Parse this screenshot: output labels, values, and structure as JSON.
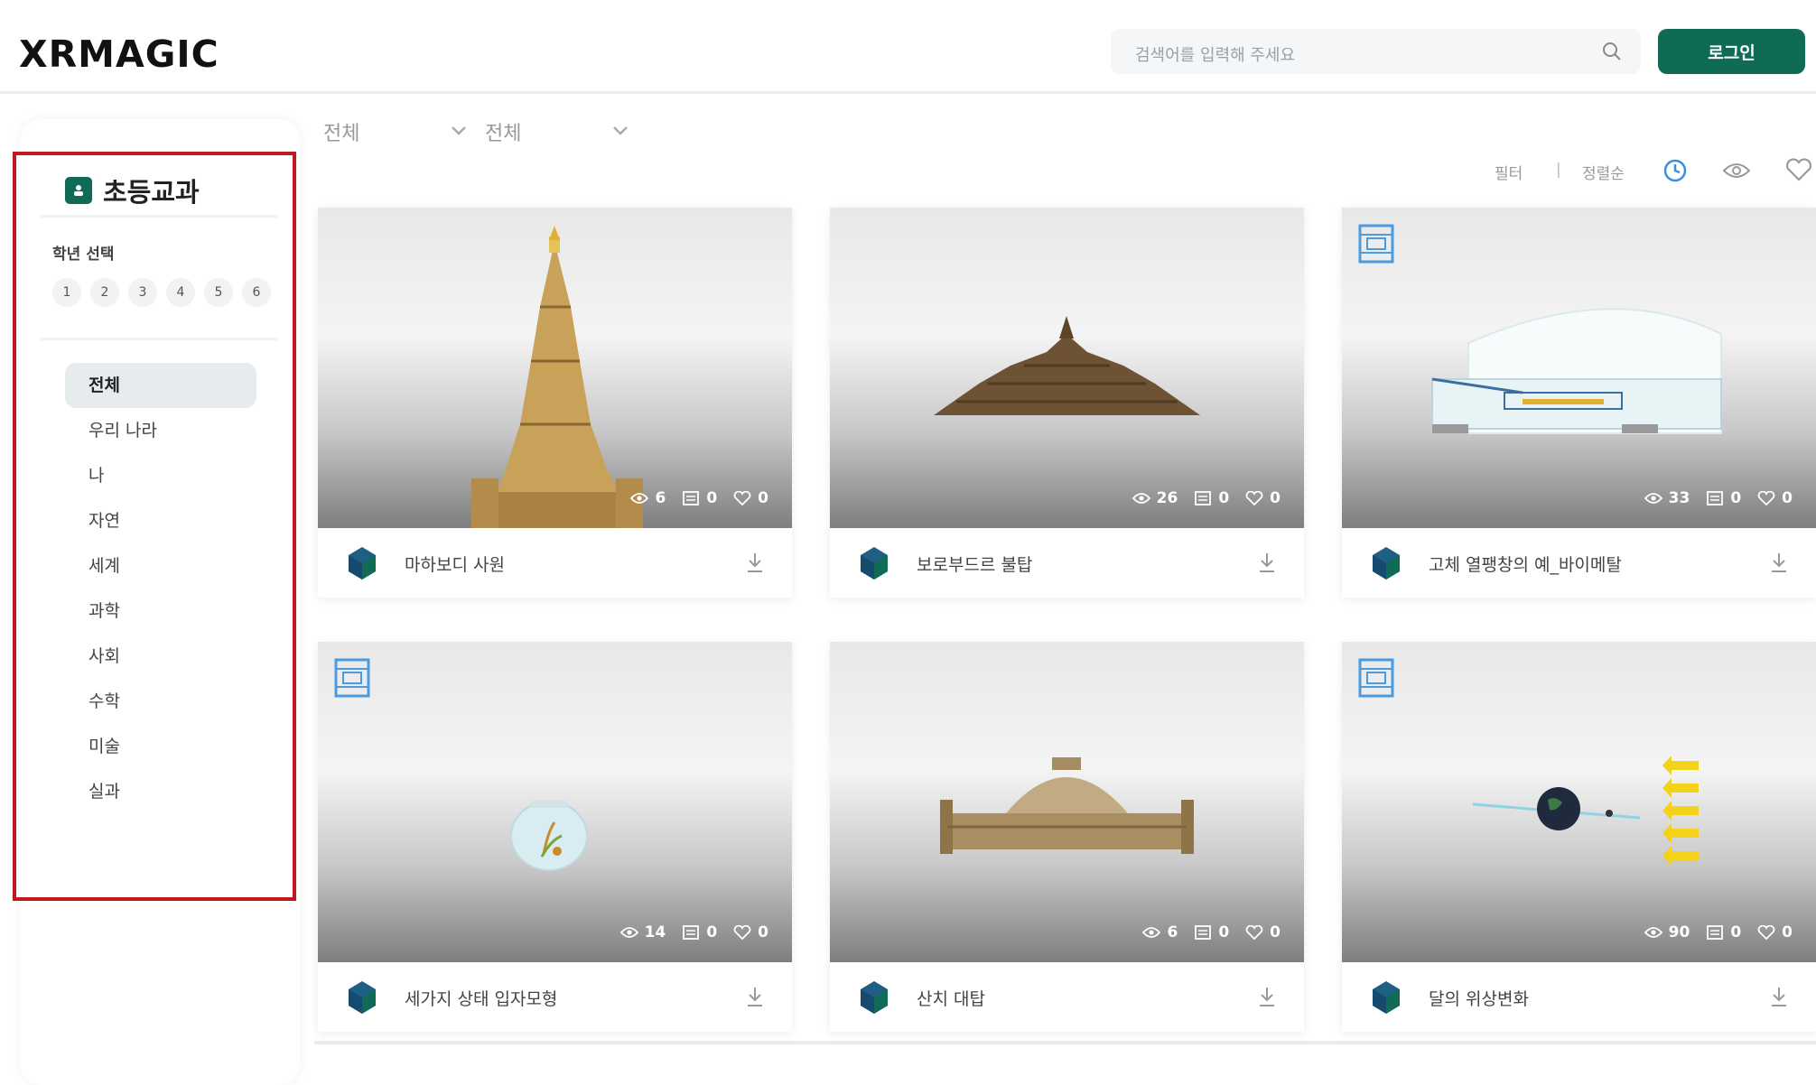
{
  "header": {
    "logo": "XRMAGIC",
    "search_placeholder": "검색어를 입력해 주세요",
    "login_label": "로그인"
  },
  "sidebar": {
    "title": "초등교과",
    "grade_label": "학년 선택",
    "grades": [
      "1",
      "2",
      "3",
      "4",
      "5",
      "6"
    ],
    "categories": [
      "전체",
      "우리 나라",
      "나",
      "자연",
      "세계",
      "과학",
      "사회",
      "수학",
      "미술",
      "실과"
    ],
    "active_category": "전체"
  },
  "filters": {
    "first": "전체",
    "second": "전체"
  },
  "sort": {
    "option1": "필터",
    "separator": "|",
    "option2": "정렬순"
  },
  "cards": [
    {
      "title": "마하보디 사원",
      "views": "6",
      "comments": "0",
      "likes": "0",
      "ar": false
    },
    {
      "title": "보로부드르 불탑",
      "views": "26",
      "comments": "0",
      "likes": "0",
      "ar": false
    },
    {
      "title": "고체 열팽창의 예_바이메탈",
      "views": "33",
      "comments": "0",
      "likes": "0",
      "ar": true
    },
    {
      "title": "세가지 상태 입자모형",
      "views": "14",
      "comments": "0",
      "likes": "0",
      "ar": true
    },
    {
      "title": "산치 대탑",
      "views": "6",
      "comments": "0",
      "likes": "0",
      "ar": false
    },
    {
      "title": "달의 위상변화",
      "views": "90",
      "comments": "0",
      "likes": "0",
      "ar": true
    }
  ],
  "colors": {
    "brand_green": "#0f6b55",
    "highlight_red": "#c0181e",
    "sort_active_blue": "#3b8fe0"
  }
}
